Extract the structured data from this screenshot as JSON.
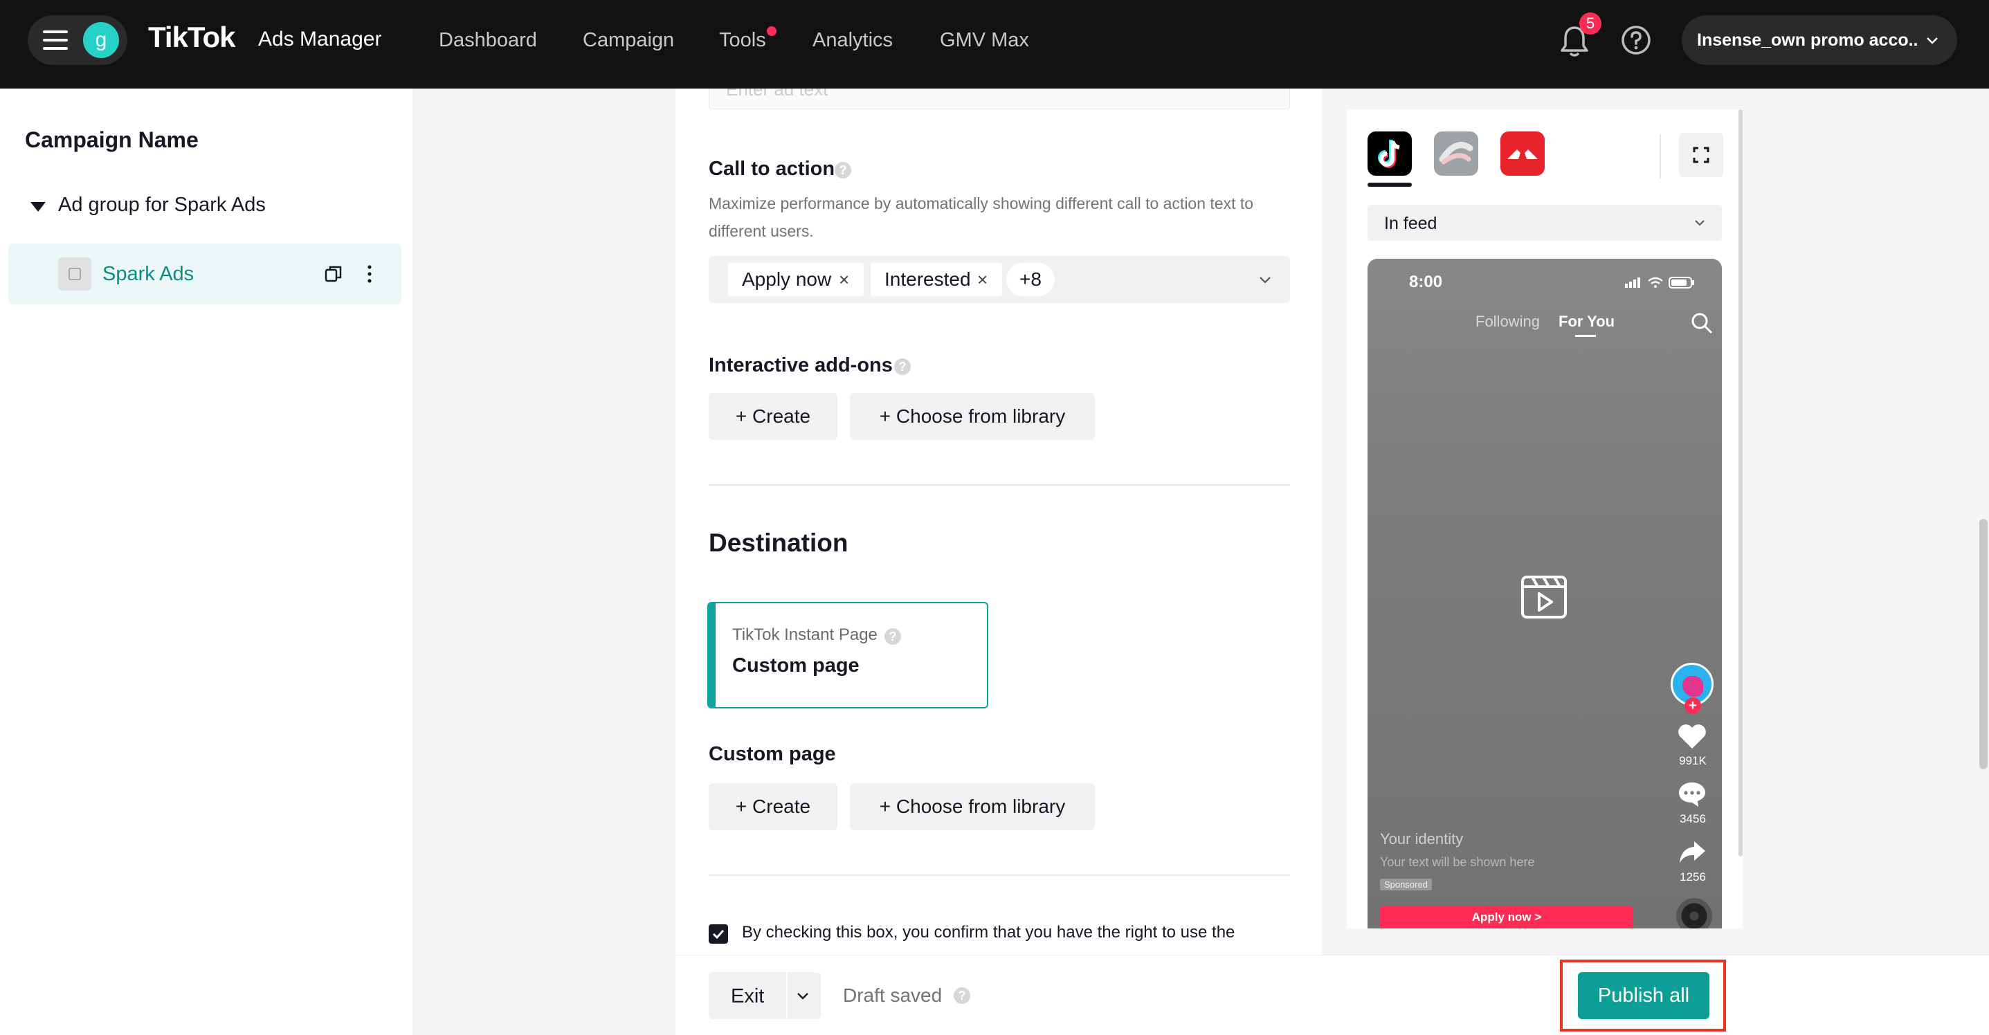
{
  "topbar": {
    "avatar_letter": "g",
    "logo": "TikTok",
    "logo_sub": "Ads Manager",
    "nav": [
      "Dashboard",
      "Campaign",
      "Tools",
      "Analytics",
      "GMV Max"
    ],
    "notification_count": "5",
    "account_name": "Insense_own promo acco..."
  },
  "sidebar": {
    "campaign_name": "Campaign Name",
    "ad_group": "Ad group for Spark Ads",
    "ad": "Spark Ads"
  },
  "form": {
    "ad_text_placeholder": "Enter ad text",
    "cta": {
      "label": "Call to action",
      "description": "Maximize performance by automatically showing different call to action text to different users.",
      "tags": [
        "Apply now",
        "Interested"
      ],
      "more": "+8"
    },
    "addons": {
      "label": "Interactive add-ons",
      "create": "+ Create",
      "library": "+ Choose from library"
    },
    "destination": {
      "title": "Destination",
      "card_sub": "TikTok Instant Page",
      "card_title": "Custom page"
    },
    "custom_page": {
      "label": "Custom page",
      "create": "+ Create",
      "library": "+ Choose from library"
    },
    "consent": "By checking this box, you confirm that you have the right to use the"
  },
  "actions": {
    "exit": "Exit",
    "draft": "Draft saved",
    "publish": "Publish all"
  },
  "preview": {
    "placement": "In feed",
    "time": "8:00",
    "following": "Following",
    "for_you": "For You",
    "likes": "991K",
    "comments": "3456",
    "shares": "1256",
    "identity": "Your identity",
    "text": "Your text will be shown here",
    "sponsored": "Sponsored",
    "cta": "Apply now >"
  },
  "colors": {
    "accent": "#0d9d97",
    "highlight": "#ea3323",
    "tiktok_red": "#fe2c55"
  }
}
